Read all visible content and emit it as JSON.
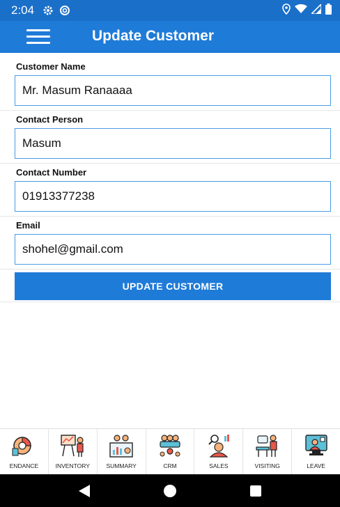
{
  "status_bar": {
    "time": "2:04"
  },
  "app_bar": {
    "title": "Update Customer"
  },
  "form": {
    "customer_name": {
      "label": "Customer Name",
      "value": "Mr. Masum Ranaaaa"
    },
    "contact_person": {
      "label": "Contact Person",
      "value": "Masum"
    },
    "contact_number": {
      "label": "Contact Number",
      "value": "01913377238"
    },
    "email": {
      "label": "Email",
      "value": "shohel@gmail.com"
    },
    "submit_label": "UPDATE CUSTOMER"
  },
  "bottom_nav": {
    "items": [
      {
        "label": "ENDANCE",
        "icon": "attendance-icon"
      },
      {
        "label": "INVENTORY",
        "icon": "inventory-icon"
      },
      {
        "label": "SUMMARY",
        "icon": "summary-icon"
      },
      {
        "label": "CRM",
        "icon": "crm-icon"
      },
      {
        "label": "SALES",
        "icon": "sales-icon"
      },
      {
        "label": "VISITING",
        "icon": "visiting-icon"
      },
      {
        "label": "LEAVE",
        "icon": "leave-icon"
      }
    ]
  },
  "colors": {
    "primary": "#1f7bd8",
    "status": "#1a6fc9",
    "input_border": "#4a9be6"
  }
}
